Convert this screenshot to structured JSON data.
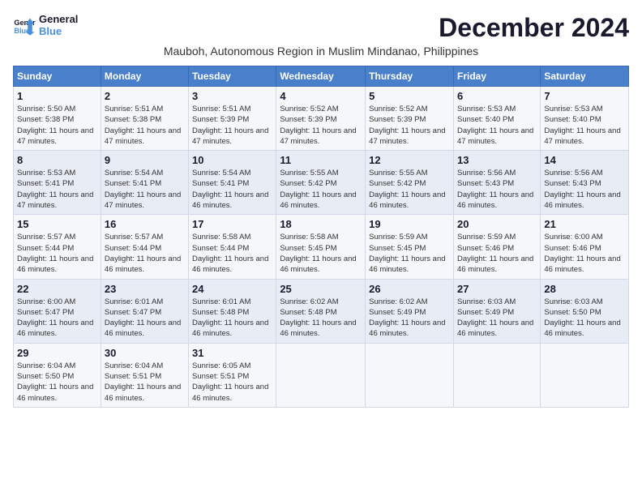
{
  "header": {
    "logo_line1": "General",
    "logo_line2": "Blue",
    "month_year": "December 2024",
    "location": "Mauboh, Autonomous Region in Muslim Mindanao, Philippines"
  },
  "weekdays": [
    "Sunday",
    "Monday",
    "Tuesday",
    "Wednesday",
    "Thursday",
    "Friday",
    "Saturday"
  ],
  "weeks": [
    [
      {
        "day": "1",
        "sunrise": "5:50 AM",
        "sunset": "5:38 PM",
        "daylight": "11 hours and 47 minutes."
      },
      {
        "day": "2",
        "sunrise": "5:51 AM",
        "sunset": "5:38 PM",
        "daylight": "11 hours and 47 minutes."
      },
      {
        "day": "3",
        "sunrise": "5:51 AM",
        "sunset": "5:39 PM",
        "daylight": "11 hours and 47 minutes."
      },
      {
        "day": "4",
        "sunrise": "5:52 AM",
        "sunset": "5:39 PM",
        "daylight": "11 hours and 47 minutes."
      },
      {
        "day": "5",
        "sunrise": "5:52 AM",
        "sunset": "5:39 PM",
        "daylight": "11 hours and 47 minutes."
      },
      {
        "day": "6",
        "sunrise": "5:53 AM",
        "sunset": "5:40 PM",
        "daylight": "11 hours and 47 minutes."
      },
      {
        "day": "7",
        "sunrise": "5:53 AM",
        "sunset": "5:40 PM",
        "daylight": "11 hours and 47 minutes."
      }
    ],
    [
      {
        "day": "8",
        "sunrise": "5:53 AM",
        "sunset": "5:41 PM",
        "daylight": "11 hours and 47 minutes."
      },
      {
        "day": "9",
        "sunrise": "5:54 AM",
        "sunset": "5:41 PM",
        "daylight": "11 hours and 47 minutes."
      },
      {
        "day": "10",
        "sunrise": "5:54 AM",
        "sunset": "5:41 PM",
        "daylight": "11 hours and 46 minutes."
      },
      {
        "day": "11",
        "sunrise": "5:55 AM",
        "sunset": "5:42 PM",
        "daylight": "11 hours and 46 minutes."
      },
      {
        "day": "12",
        "sunrise": "5:55 AM",
        "sunset": "5:42 PM",
        "daylight": "11 hours and 46 minutes."
      },
      {
        "day": "13",
        "sunrise": "5:56 AM",
        "sunset": "5:43 PM",
        "daylight": "11 hours and 46 minutes."
      },
      {
        "day": "14",
        "sunrise": "5:56 AM",
        "sunset": "5:43 PM",
        "daylight": "11 hours and 46 minutes."
      }
    ],
    [
      {
        "day": "15",
        "sunrise": "5:57 AM",
        "sunset": "5:44 PM",
        "daylight": "11 hours and 46 minutes."
      },
      {
        "day": "16",
        "sunrise": "5:57 AM",
        "sunset": "5:44 PM",
        "daylight": "11 hours and 46 minutes."
      },
      {
        "day": "17",
        "sunrise": "5:58 AM",
        "sunset": "5:44 PM",
        "daylight": "11 hours and 46 minutes."
      },
      {
        "day": "18",
        "sunrise": "5:58 AM",
        "sunset": "5:45 PM",
        "daylight": "11 hours and 46 minutes."
      },
      {
        "day": "19",
        "sunrise": "5:59 AM",
        "sunset": "5:45 PM",
        "daylight": "11 hours and 46 minutes."
      },
      {
        "day": "20",
        "sunrise": "5:59 AM",
        "sunset": "5:46 PM",
        "daylight": "11 hours and 46 minutes."
      },
      {
        "day": "21",
        "sunrise": "6:00 AM",
        "sunset": "5:46 PM",
        "daylight": "11 hours and 46 minutes."
      }
    ],
    [
      {
        "day": "22",
        "sunrise": "6:00 AM",
        "sunset": "5:47 PM",
        "daylight": "11 hours and 46 minutes."
      },
      {
        "day": "23",
        "sunrise": "6:01 AM",
        "sunset": "5:47 PM",
        "daylight": "11 hours and 46 minutes."
      },
      {
        "day": "24",
        "sunrise": "6:01 AM",
        "sunset": "5:48 PM",
        "daylight": "11 hours and 46 minutes."
      },
      {
        "day": "25",
        "sunrise": "6:02 AM",
        "sunset": "5:48 PM",
        "daylight": "11 hours and 46 minutes."
      },
      {
        "day": "26",
        "sunrise": "6:02 AM",
        "sunset": "5:49 PM",
        "daylight": "11 hours and 46 minutes."
      },
      {
        "day": "27",
        "sunrise": "6:03 AM",
        "sunset": "5:49 PM",
        "daylight": "11 hours and 46 minutes."
      },
      {
        "day": "28",
        "sunrise": "6:03 AM",
        "sunset": "5:50 PM",
        "daylight": "11 hours and 46 minutes."
      }
    ],
    [
      {
        "day": "29",
        "sunrise": "6:04 AM",
        "sunset": "5:50 PM",
        "daylight": "11 hours and 46 minutes."
      },
      {
        "day": "30",
        "sunrise": "6:04 AM",
        "sunset": "5:51 PM",
        "daylight": "11 hours and 46 minutes."
      },
      {
        "day": "31",
        "sunrise": "6:05 AM",
        "sunset": "5:51 PM",
        "daylight": "11 hours and 46 minutes."
      },
      null,
      null,
      null,
      null
    ]
  ]
}
